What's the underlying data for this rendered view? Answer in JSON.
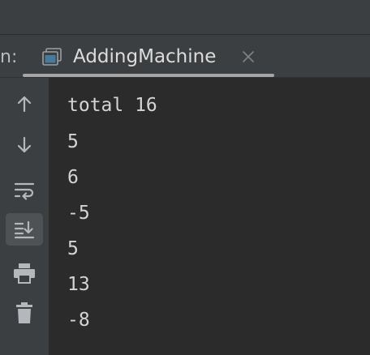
{
  "run_panel": {
    "prefix": "n:",
    "tab": {
      "label": "AddingMachine",
      "icon": "console-window-icon",
      "close_icon": "close-icon"
    }
  },
  "toolbar": {
    "items": [
      {
        "icon": "arrow-up-icon",
        "tooltip": ""
      },
      {
        "icon": "arrow-down-icon",
        "tooltip": ""
      },
      {
        "icon": "soft-wrap-icon",
        "tooltip": ""
      },
      {
        "icon": "scroll-to-end-icon",
        "tooltip": "",
        "active": true
      },
      {
        "icon": "print-icon",
        "tooltip": ""
      },
      {
        "icon": "trash-icon",
        "tooltip": ""
      }
    ]
  },
  "console": {
    "lines": [
      "total 16",
      "5",
      "6",
      "-5",
      "5",
      "13",
      "-8"
    ]
  },
  "colors": {
    "panel_bg": "#3c3f41",
    "console_bg": "#2b2b2b",
    "text": "#d4d4d4",
    "icon": "#b4b8bc"
  }
}
